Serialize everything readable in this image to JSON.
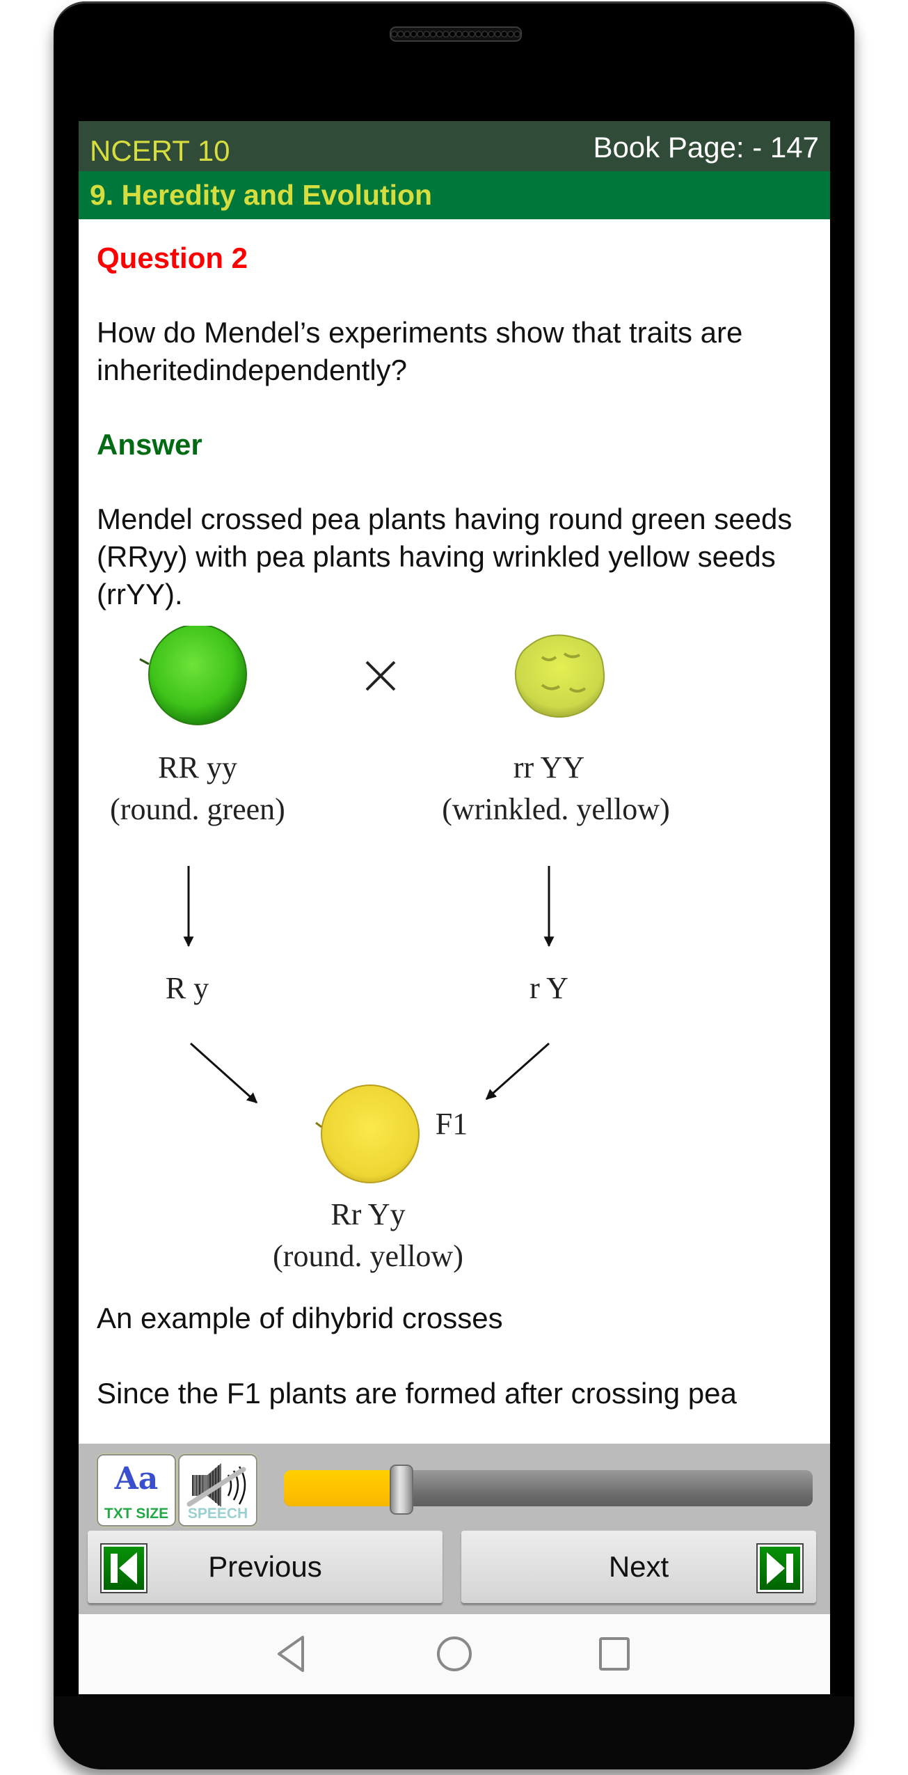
{
  "header": {
    "app_title": "NCERT 10",
    "book_page": "Book Page: - 147",
    "chapter": "9. Heredity and Evolution"
  },
  "content": {
    "question_title": "Question 2",
    "question_text": "How do Mendel’s experiments show that traits are inheritedindependently?",
    "answer_title": "Answer",
    "answer_text": "Mendel crossed pea plants having round green seeds (RRyy) with pea plants having wrinkled yellow seeds (rrYY).",
    "diagram": {
      "cross_symbol": "×",
      "parent1_genotype": "RR yy",
      "parent1_phenotype": "(round. green)",
      "parent2_genotype": "rr YY",
      "parent2_phenotype": "(wrinkled. yellow)",
      "gamete1": "R y",
      "gamete2": "r Y",
      "f1_label": "F1",
      "f1_genotype": "Rr Yy",
      "f1_phenotype": "(round. yellow)",
      "colors": {
        "green_seed": "#4fd020",
        "yellow_wrinkled_seed": "#d6e54a",
        "yellow_seed": "#f2dc3a"
      }
    },
    "caption": "An example of dihybrid crosses",
    "next_paragraph": "Since the F1 plants are formed after crossing pea"
  },
  "controls": {
    "text_size_label": "TXT SIZE",
    "text_size_glyph": "Aa",
    "speech_label": "SPEECH",
    "speech_state": "muted",
    "slider_value": 0.22,
    "slider_colors": {
      "fill": "#ffc800",
      "track": "#6e6e6e"
    }
  },
  "navigation": {
    "previous_label": "Previous",
    "next_label": "Next"
  },
  "system_nav": {
    "back": "back-icon",
    "home": "home-icon",
    "recents": "recents-icon"
  },
  "theme": {
    "header_dark": "#304b38",
    "header_green": "#00773a",
    "header_text": "#d6dd3f",
    "question_color": "#ff0000",
    "answer_color": "#006b12"
  }
}
